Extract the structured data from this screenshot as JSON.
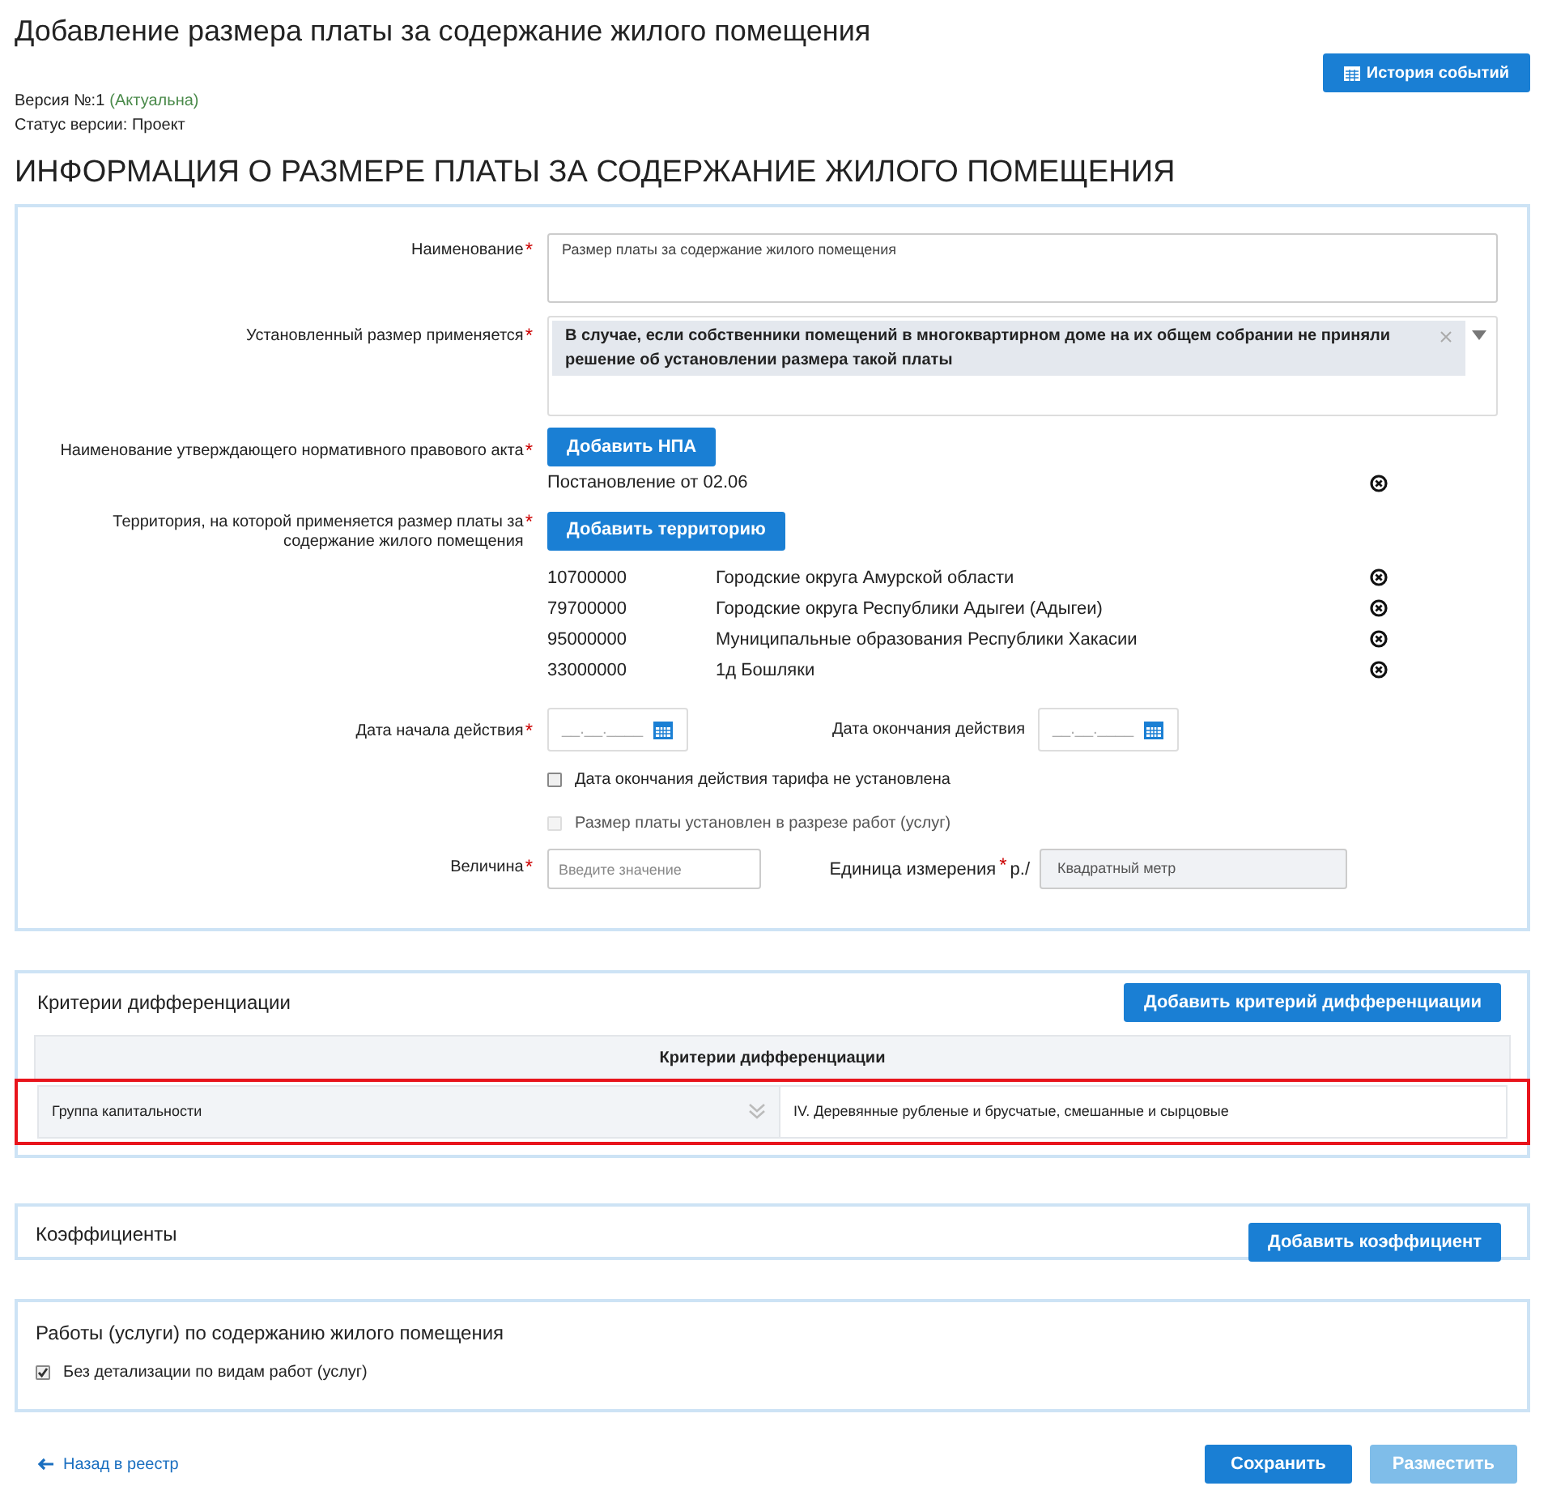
{
  "page_title": "Добавление размера платы за содержание жилого помещения",
  "history_button": {
    "label": "История событий"
  },
  "version": {
    "label": "Версия №:1",
    "state": "(Актуальна)"
  },
  "status": "Статус версии: Проект",
  "section_title": "ИНФОРМАЦИЯ О РАЗМЕРЕ ПЛАТЫ ЗА СОДЕРЖАНИЕ ЖИЛОГО ПОМЕЩЕНИЯ",
  "form": {
    "name": {
      "label": "Наименование",
      "mark": "*",
      "value": "Размер платы за содержание жилого помещения"
    },
    "applies": {
      "label": "Установленный размер применяется",
      "mark": "*",
      "chip": "В случае, если собственники помещений в многоквартирном доме на их общем собрании не приняли решение об установлении размера такой платы"
    },
    "act": {
      "label": "Наименование утверждающего нормативного правового акта",
      "mark": "*",
      "button": "Добавить НПА",
      "items": [
        {
          "name": "Постановление от 02.06"
        }
      ]
    },
    "territory": {
      "label": "Территория, на которой применяется размер платы за содержание жилого помещения",
      "mark": "*",
      "button": "Добавить территорию",
      "items": [
        {
          "code": "10700000",
          "name": "Городские округа Амурской области"
        },
        {
          "code": "79700000",
          "name": "Городские округа Республики Адыгеи (Адыгеи)"
        },
        {
          "code": "95000000",
          "name": "Муниципальные образования Республики Хакасии"
        },
        {
          "code": "33000000",
          "name": "1д Бошляки"
        }
      ]
    },
    "start_date": {
      "label": "Дата начала действия",
      "mark": "*",
      "placeholder": "__.__.____"
    },
    "end_date": {
      "label": "Дата окончания действия",
      "placeholder": "__.__.____"
    },
    "checkboxes": [
      {
        "label": "Дата окончания действия тарифа не установлена",
        "checked": false,
        "disabled": false
      },
      {
        "label": "Размер платы установлен в разрезе работ (услуг)",
        "checked": false,
        "disabled": true
      }
    ],
    "value": {
      "label": "Величина",
      "mark": "*",
      "placeholder": "Введите значение"
    },
    "unit": {
      "label": "Единица измерения",
      "mark": "*",
      "suffix": "р./",
      "value": "Квадратный метр"
    }
  },
  "criteria": {
    "title": "Критерии дифференциации",
    "button": "Добавить критерий дифференциации",
    "table": {
      "header": "Критерии дифференциации",
      "rows": [
        {
          "name": "Группа капитальности",
          "value": "IV. Деревянные рубленые и брусчатые, смешанные и сырцовые",
          "highlighted": true
        }
      ]
    }
  },
  "coefficients": {
    "title": "Коэффициенты",
    "button": "Добавить коэффициент"
  },
  "works": {
    "title": "Работы (услуги) по содержанию жилого помещения",
    "checkboxes": [
      {
        "label": "Без детализации по видам работ (услуг)",
        "checked": true,
        "disabled": false
      }
    ]
  },
  "footer": {
    "back_link": "Назад в реестр",
    "buttons": [
      {
        "label": "Сохранить",
        "disabled": false
      },
      {
        "label": "Разместить",
        "disabled": true
      }
    ]
  }
}
